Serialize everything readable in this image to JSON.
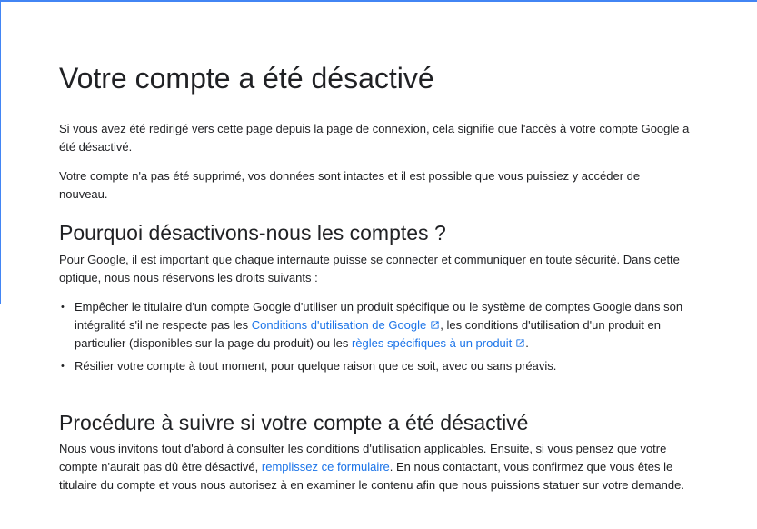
{
  "page": {
    "title": "Votre compte a été désactivé",
    "intro_paragraph_1": "Si vous avez été redirigé vers cette page depuis la page de connexion, cela signifie que l'accès à votre compte Google a été désactivé.",
    "intro_paragraph_2": "Votre compte n'a pas été supprimé, vos données sont intactes et il est possible que vous puissiez y accéder de nouveau."
  },
  "section_why": {
    "heading": "Pourquoi désactivons-nous les comptes ?",
    "paragraph": "Pour Google, il est important que chaque internaute puisse se connecter et communiquer en toute sécurité. Dans cette optique, nous nous réservons les droits suivants :",
    "bullet_1": {
      "text_before": "Empêcher le titulaire d'un compte Google d'utiliser un produit spécifique ou le système de comptes Google dans son intégralité s'il ne respecte pas les ",
      "link_1": "Conditions d'utilisation de Google",
      "text_middle": ", les conditions d'utilisation d'un produit en particulier (disponibles sur la page du produit) ou les ",
      "link_2": "règles spécifiques à un produit",
      "text_after": "."
    },
    "bullet_2": "Résilier votre compte à tout moment, pour quelque raison que ce soit, avec ou sans préavis."
  },
  "section_procedure": {
    "heading": "Procédure à suivre si votre compte a été désactivé",
    "text_before": "Nous vous invitons tout d'abord à consulter les conditions d'utilisation applicables. Ensuite, si vous pensez que votre compte n'aurait pas dû être désactivé, ",
    "link": "remplissez ce formulaire",
    "text_after": ". En nous contactant, vous confirmez que vous êtes le titulaire du compte et vous nous autorisez à en examiner le contenu afin que nous puissions statuer sur votre demande."
  },
  "icons": {
    "external_link": "external-link-icon"
  },
  "colors": {
    "accent": "#4285f4",
    "link": "#1a73e8",
    "text": "#202124"
  }
}
